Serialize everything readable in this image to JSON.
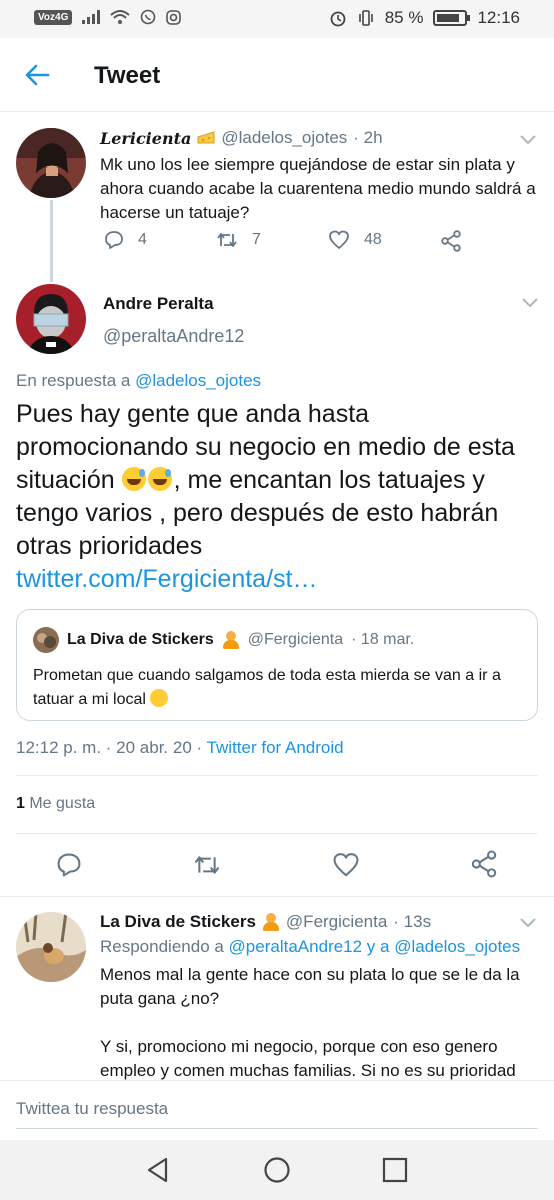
{
  "statusbar": {
    "carrier": "Voz4G",
    "battery": "85 %",
    "battery_level": 0.85,
    "time": "12:16"
  },
  "header": {
    "title": "Tweet",
    "back_icon": "arrow-left-icon"
  },
  "tweet1": {
    "name": "Lericienta",
    "handle": "@ladelos_ojotes",
    "time": "· 2h",
    "text": "Mk uno los lee siempre quejándose de estar sin plata y ahora cuando acabe la cuarentena medio mundo saldrá a hacerse un tatuaje?",
    "replies": "4",
    "retweets": "7",
    "likes": "48"
  },
  "tweet2": {
    "name": "Andre Peralta",
    "handle": "@peraltaAndre12",
    "reply_prefix": "En respuesta a ",
    "reply_to": "@ladelos_ojotes",
    "text_part1": "Pues hay gente que anda hasta promocionando su negocio en medio de esta situación ",
    "text_part2": ", me encantan los tatuajes y tengo varios , pero después de esto habrán otras prioridades",
    "link": "twitter.com/Fergicienta/st…",
    "quote": {
      "name": "La Diva de Stickers",
      "handle": "@Fergicienta",
      "time": "· 18 mar.",
      "text": "Prometan que cuando salgamos de toda esta mierda se van a ir a tatuar a mi local "
    },
    "time": "12:12 p. m. · 20 abr. 20 · ",
    "source": "Twitter for Android",
    "likes_count": "1",
    "likes_label": " Me gusta"
  },
  "tweet3": {
    "name": "La Diva de Stickers",
    "handle": "@Fergicienta",
    "time": "· 13s",
    "reply_prefix": "Respondiendo a ",
    "reply_to_1": "@peraltaAndre12",
    "reply_joiner": " y a ",
    "reply_to_2": "@ladelos_ojotes",
    "text_p1": "Menos mal la gente hace con su plata lo que se le da la puta gana ¿no?",
    "text_p2": "Y si, promociono mi negocio, porque con eso genero empleo y comen muchas familias. Si no es su prioridad"
  },
  "reply_bar": {
    "placeholder": "Twittea tu respuesta"
  },
  "colors": {
    "accent": "#1b95e0",
    "muted": "#657786",
    "border": "#e6ecf0"
  }
}
